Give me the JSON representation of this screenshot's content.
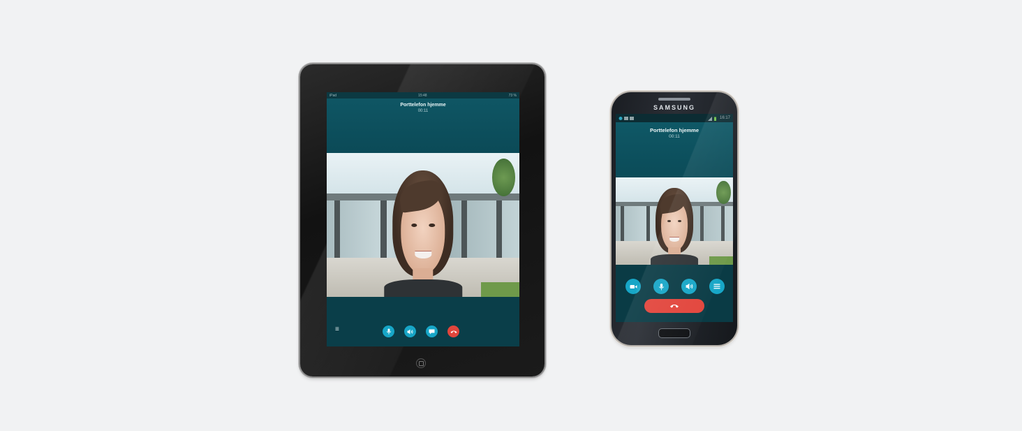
{
  "ipad": {
    "status": {
      "carrier": "iPad",
      "clock": "15:48",
      "battery": "73 %"
    },
    "call": {
      "name": "Porttelefon hjemme",
      "duration": "00:11"
    },
    "controls": [
      "menu-icon",
      "microphone-icon",
      "speaker-icon",
      "chat-icon",
      "hangup-icon"
    ],
    "home_button": "home-button"
  },
  "phone": {
    "brand": "SAMSUNG",
    "status": {
      "clock": "16:17"
    },
    "call": {
      "name": "Porttelefon hjemme",
      "duration": "00:11"
    },
    "controls": [
      "video-icon",
      "microphone-icon",
      "speaker-icon",
      "menu-icon"
    ],
    "end_call": "hangup-icon"
  },
  "colors": {
    "background": "#f1f2f3",
    "call_header": "#0f5664",
    "control_button": "#17a6c7",
    "hangup": "#e2453c"
  }
}
